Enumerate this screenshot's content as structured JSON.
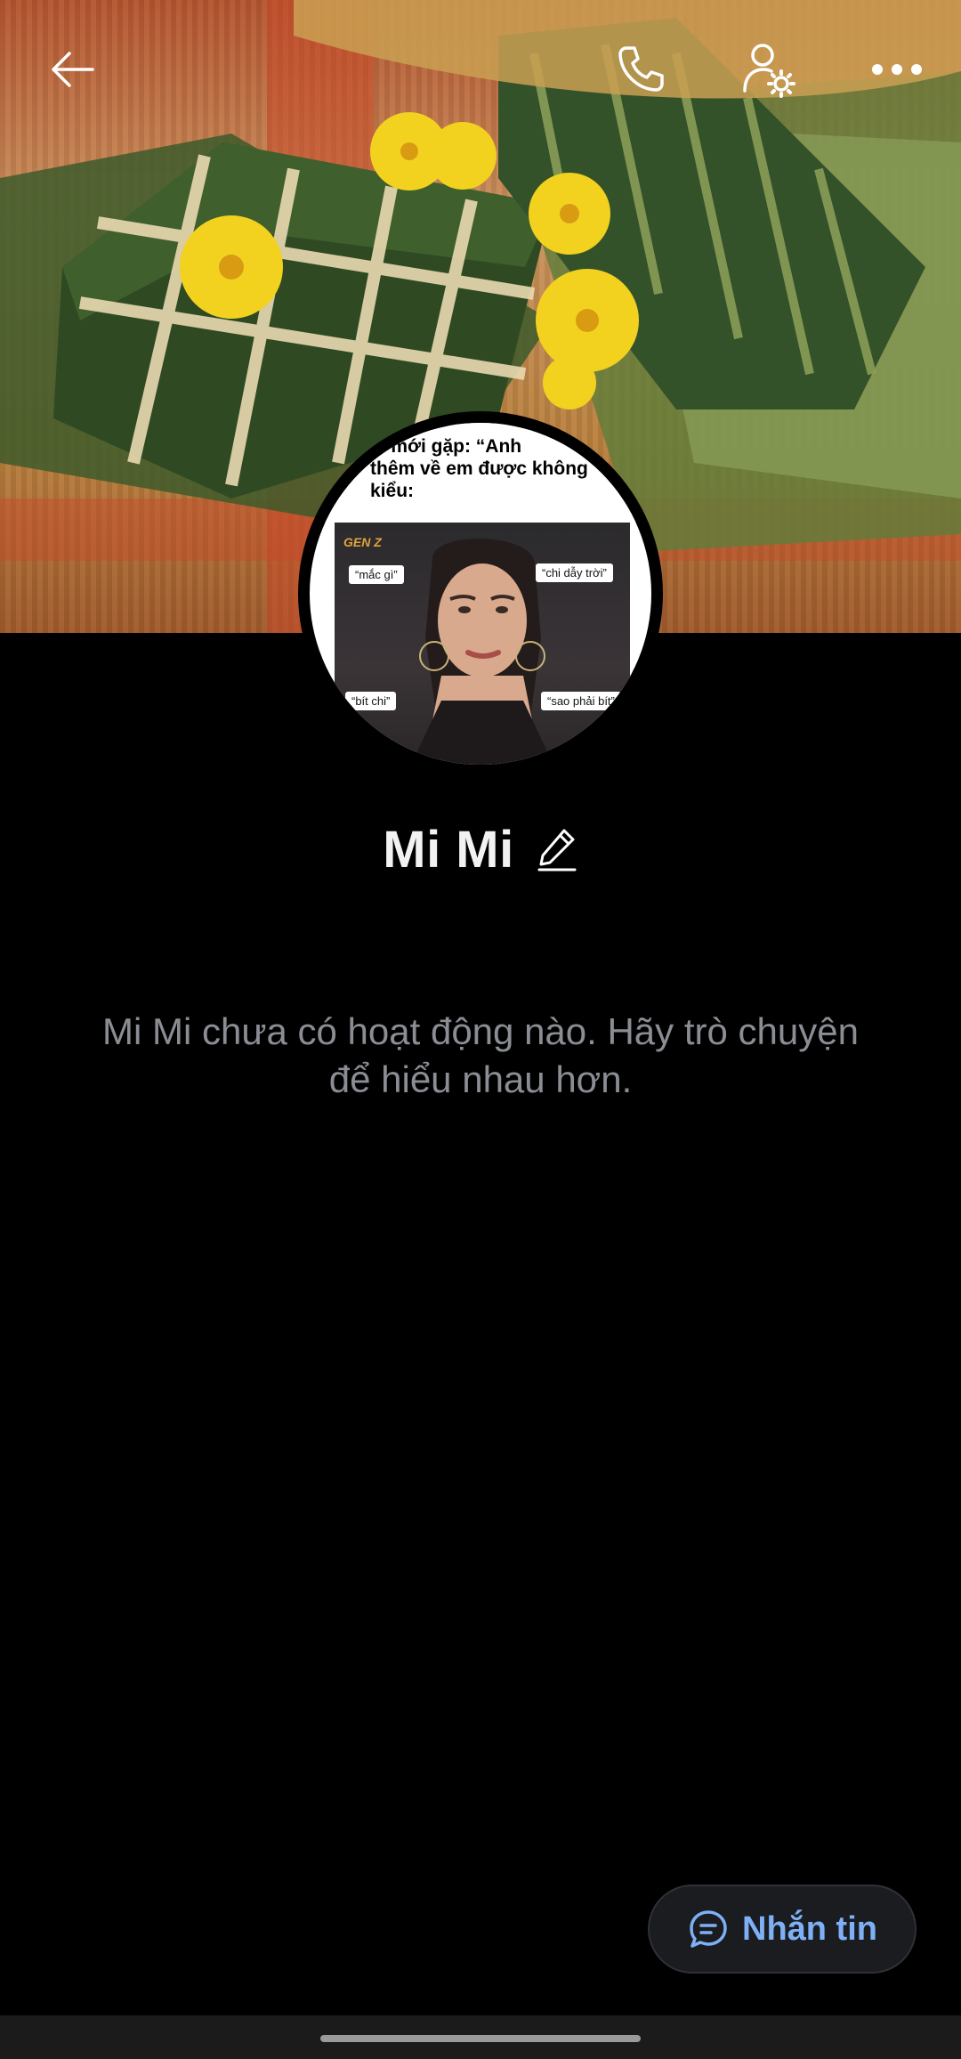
{
  "profile": {
    "name": "Mi Mi",
    "empty_message": "Mi Mi chưa có hoạt động nào. Hãy trò chuyện để hiểu nhau hơn."
  },
  "avatar_meme": {
    "caption_line1": "ai mới gặp: “Anh",
    "caption_line2": "thêm về em được không",
    "caption_line3": "kiểu:",
    "brand": "GEN Z",
    "bubble_1": "“mắc gì”",
    "bubble_2": "“chi dẫy trời”",
    "bubble_3": "“bít chi”",
    "bubble_4": "“sao phải bít”"
  },
  "actions": {
    "message_label": "Nhắn tin"
  },
  "icons": {
    "back": "back-arrow-icon",
    "call": "phone-icon",
    "settings": "user-settings-icon",
    "more": "more-horizontal-icon",
    "edit": "pencil-icon",
    "message": "chat-bubble-icon"
  },
  "colors": {
    "background": "#000000",
    "accent": "#7fb0f5",
    "muted_text": "#8a8e94"
  }
}
